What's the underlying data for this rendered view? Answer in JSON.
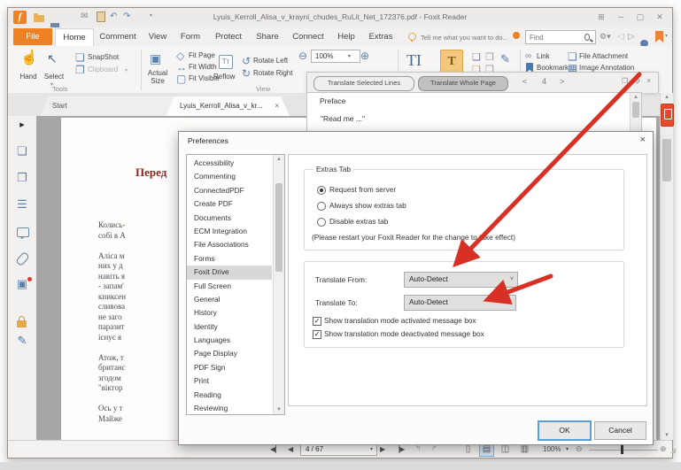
{
  "window": {
    "title": "Lyuis_Kerroll_Alisa_v_krayni_chudes_RuLit_Net_172376.pdf - Foxit Reader"
  },
  "menu": {
    "tabs": [
      "File",
      "Home",
      "Comment",
      "View",
      "Form",
      "Protect",
      "Share",
      "Connect",
      "Help",
      "Extras"
    ],
    "tell_me": "Tell me what you want to do...",
    "find_placeholder": "Find"
  },
  "ribbon": {
    "tools_group_label": "Tools",
    "hand": "Hand",
    "select": "Select",
    "snapshot": "SnapShot",
    "clipboard": "Clipboard",
    "view_group_label": "View",
    "actual_size_line1": "Actual",
    "actual_size_line2": "Size",
    "fit_page": "Fit Page",
    "fit_width": "Fit Width",
    "fit_visible": "Fit Visible",
    "reflow": "Reflow",
    "rotate_left": "Rotate Left",
    "rotate_right": "Rotate Right",
    "zoom_value": "100%",
    "typewriter": "TI",
    "highlight": "T",
    "link": "Link",
    "bookmark": "Bookmark",
    "file_attachment": "File Attachment",
    "image_annotation": "Image Annotation"
  },
  "translate_bar": {
    "selected_lines": "Translate Selected Lines",
    "whole_page": "Translate Whole Page",
    "prev": "<",
    "page": "4",
    "next": ">"
  },
  "translate_panel": {
    "title": "Preface",
    "body": "\"Read me ...\""
  },
  "doc_tabs": {
    "start": "Start",
    "document": "Lyuis_Kerroll_Alisa_v_kr...",
    "close": "×"
  },
  "document": {
    "heading": "Перед",
    "lines": [
      "Колись-",
      "собі в А",
      "",
      "Аліса м",
      "них у д",
      "навіть я",
      "- запам'",
      "книксен",
      "сливова",
      "не заго",
      "паразит",
      "існує я",
      "",
      "Атож, т",
      "британс",
      "згодом",
      "\"віктор",
      "",
      "Ось у т",
      "Майже"
    ]
  },
  "preferences": {
    "title": "Preferences",
    "close": "×",
    "categories": [
      "Accessibility",
      "Commenting",
      "ConnectedPDF",
      "Create PDF",
      "Documents",
      "ECM Integration",
      "File Associations",
      "Forms",
      "Foxit Drive",
      "Full Screen",
      "General",
      "History",
      "Identity",
      "Languages",
      "Page Display",
      "PDF Sign",
      "Print",
      "Reading",
      "Reviewing"
    ],
    "selected_category": "Foxit Drive",
    "extras_tab": {
      "legend": "Extras Tab",
      "radio_request": "Request from server",
      "radio_always": "Always show extras tab",
      "radio_disable": "Disable extras tab",
      "note": "(Please restart your Foxit Reader for the change to take effect)"
    },
    "translate": {
      "from_label": "Translate From:",
      "to_label": "Translate To:",
      "from_value": "Auto-Detect",
      "to_value": "Auto-Detect",
      "checkbox_activated": "Show translation mode activated message box",
      "checkbox_deactivated": "Show translation mode deactivated message box"
    },
    "ok": "OK",
    "cancel": "Cancel"
  },
  "status_bar": {
    "page": "4 / 67",
    "zoom": "100%"
  },
  "colors": {
    "accent_orange": "#EE8133",
    "arrow_red": "#D93025",
    "selection_gray": "#D8D8D8",
    "focus_blue": "#5A9FD4"
  }
}
